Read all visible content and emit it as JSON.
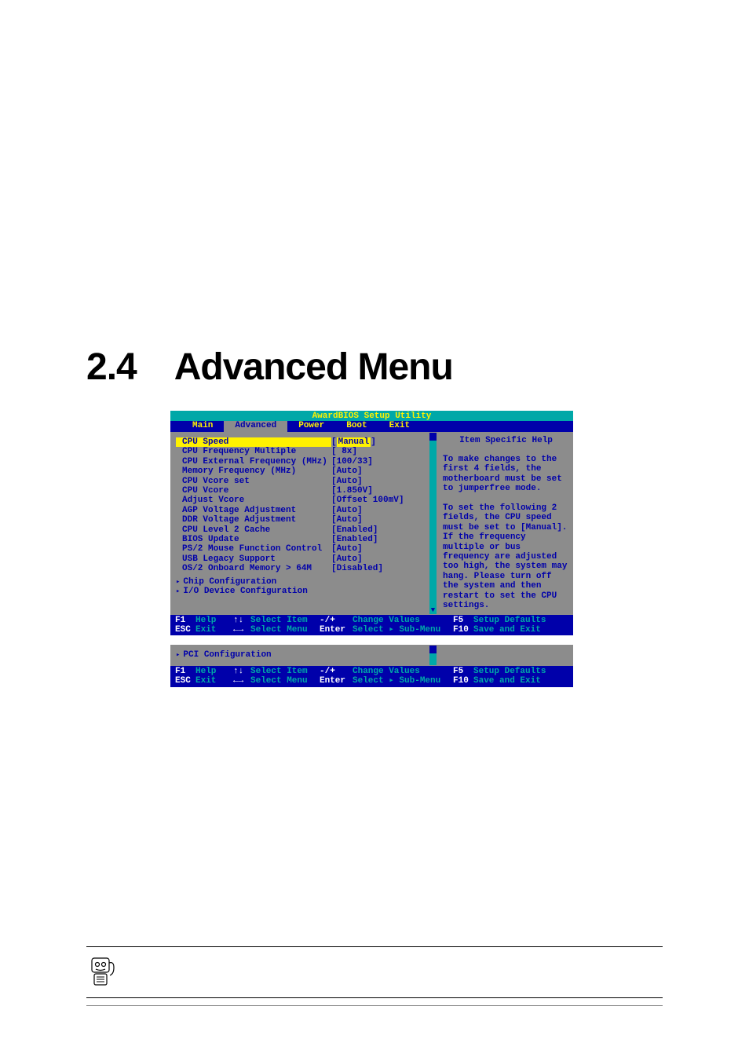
{
  "heading": {
    "number": "2.4",
    "title": "Advanced Menu"
  },
  "bios1": {
    "title": "AwardBIOS Setup Utility",
    "menus": [
      "Main",
      "Advanced",
      "Power",
      "Boot",
      "Exit"
    ],
    "selected_menu": "Advanced",
    "rows": [
      {
        "label": "CPU Speed",
        "value": "Manual",
        "highlight": true
      },
      {
        "label": "CPU Frequency Multiple",
        "value": "[ 8x]"
      },
      {
        "label": "CPU External Frequency (MHz)",
        "value": "[100/33]"
      },
      {
        "label": "Memory Frequency (MHz)",
        "value": "[Auto]"
      },
      {
        "label": "CPU Vcore set",
        "value": "[Auto]"
      },
      {
        "label": "CPU Vcore",
        "value": "[1.850V]"
      },
      {
        "label": "Adjust Vcore",
        "value": "[Offset 100mV]"
      },
      {
        "label": "AGP Voltage Adjustment",
        "value": "[Auto]"
      },
      {
        "label": "DDR Voltage Adjustment",
        "value": "[Auto]"
      },
      {
        "label": "CPU Level 2 Cache",
        "value": "[Enabled]"
      },
      {
        "label": "BIOS Update",
        "value": "[Enabled]"
      },
      {
        "label": "PS/2 Mouse Function Control",
        "value": "[Auto]"
      },
      {
        "label": "USB Legacy Support",
        "value": "[Auto]"
      },
      {
        "label": "OS/2 Onboard Memory > 64M",
        "value": "[Disabled]"
      }
    ],
    "submenus": [
      "Chip Configuration",
      "I/O Device Configuration"
    ],
    "help_title": "Item Specific Help",
    "help_text": "To make changes to the first 4 fields, the motherboard must be set to jumperfree mode.\n\nTo set the following 2 fields, the CPU speed must be set to [Manual]. If the frequency multiple or bus frequency are adjusted too high, the system may hang. Please turn off the system and then restart to set the CPU settings.",
    "footer": {
      "f1": "F1",
      "help": "Help",
      "updn": "↑↓",
      "select_item": "Select Item",
      "minplus": "-/+",
      "change_values": "Change Values",
      "f5": "F5",
      "setup_defaults": "Setup Defaults",
      "esc": "ESC",
      "exit": "Exit",
      "leftright": "←→",
      "select_menu": "Select Menu",
      "enter": "Enter",
      "select_submenu": "Select ▸ Sub-Menu",
      "f10": "F10",
      "save_exit": "Save and Exit"
    }
  },
  "bios2": {
    "submenus": [
      "PCI Configuration"
    ],
    "footer_same_as": "bios1"
  }
}
